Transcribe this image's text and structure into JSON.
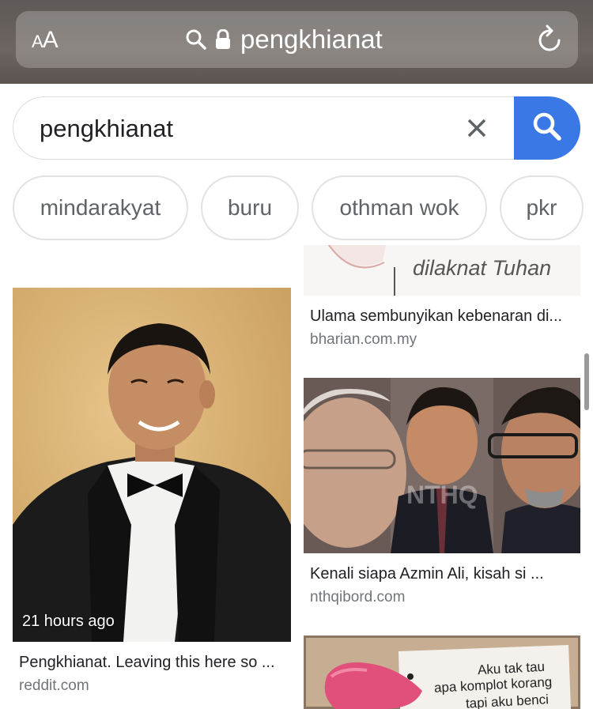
{
  "browser": {
    "text_size_label_small": "A",
    "text_size_label_large": "A",
    "url": "pengkhianat"
  },
  "search": {
    "query": "pengkhianat"
  },
  "chips": [
    "mindarakyat",
    "buru",
    "othman wok",
    "pkr"
  ],
  "results": {
    "top_right_image_text": "dilaknat Tuhan",
    "top_right_title": "Ulama sembunyikan kebenaran di...",
    "top_right_source": "bharian.com.my",
    "left_time": "21 hours ago",
    "left_title": "Pengkhianat. Leaving this here so ...",
    "left_source": "reddit.com",
    "mid_right_watermark": "NTHQ",
    "mid_right_title": "Kenali siapa Azmin Ali, kisah si ...",
    "mid_right_source": "nthqibord.com",
    "bottom_note_line1": "Aku tak tau",
    "bottom_note_line2": "apa komplot korang",
    "bottom_note_line3": "tapi aku benci"
  }
}
